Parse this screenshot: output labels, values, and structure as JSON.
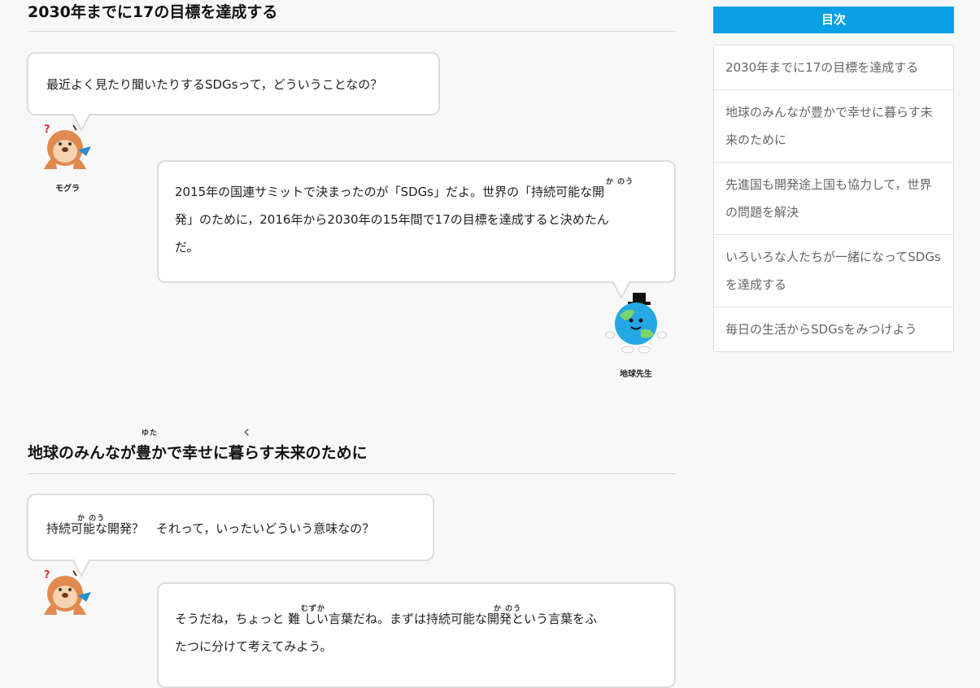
{
  "sections": [
    {
      "heading": "2030年までに17の目標を達成する",
      "mole_bubble": "最近よく見たり聞いたりするSDGsって，どういうことなの？",
      "earth_bubble": {
        "line1": "2015年の国連サミットで決まったのが「SDGs」だよ。世界の「持続可能な開",
        "line1_ruby": "か のう",
        "line2": "発」のために，2016年から2030年の15年間で17の目標を達成すると決めたん",
        "line3": "だ。"
      }
    },
    {
      "heading": "地球のみんなが豊かで幸せに暮らす未来のために",
      "heading_ruby_yuta": "ゆた",
      "heading_ruby_ku": "く",
      "mole_bubble": "持続可能な開発？　それって，いったいどういう意味なの？",
      "mole_bubble_ruby": "か のう",
      "earth_bubble": {
        "line1": "そうだね，ちょっと 難 しい言葉だね。まずは持続可能な開発という言葉をふ",
        "ruby_muzu": "むずか",
        "ruby_kanou": "か のう",
        "line2": "たつに分けて考えてみよう。"
      }
    }
  ],
  "characters": {
    "mole_name": "モグラ",
    "earth_name": "地球先生",
    "mole_question_mark": "?"
  },
  "toc": {
    "title": "目次",
    "items": [
      "2030年までに17の目標を達成する",
      "地球のみんなが豊かで幸せに暮らす未来のために",
      "先進国も開発途上国も協力して，世界の問題を解決",
      "いろいろな人たちが一緒になってSDGsを達成する",
      "毎日の生活からSDGsをみつけよう"
    ]
  },
  "colors": {
    "accent": "#0aa0e4",
    "bubble_border": "#dcdcdc",
    "background": "#f8f8f8"
  }
}
